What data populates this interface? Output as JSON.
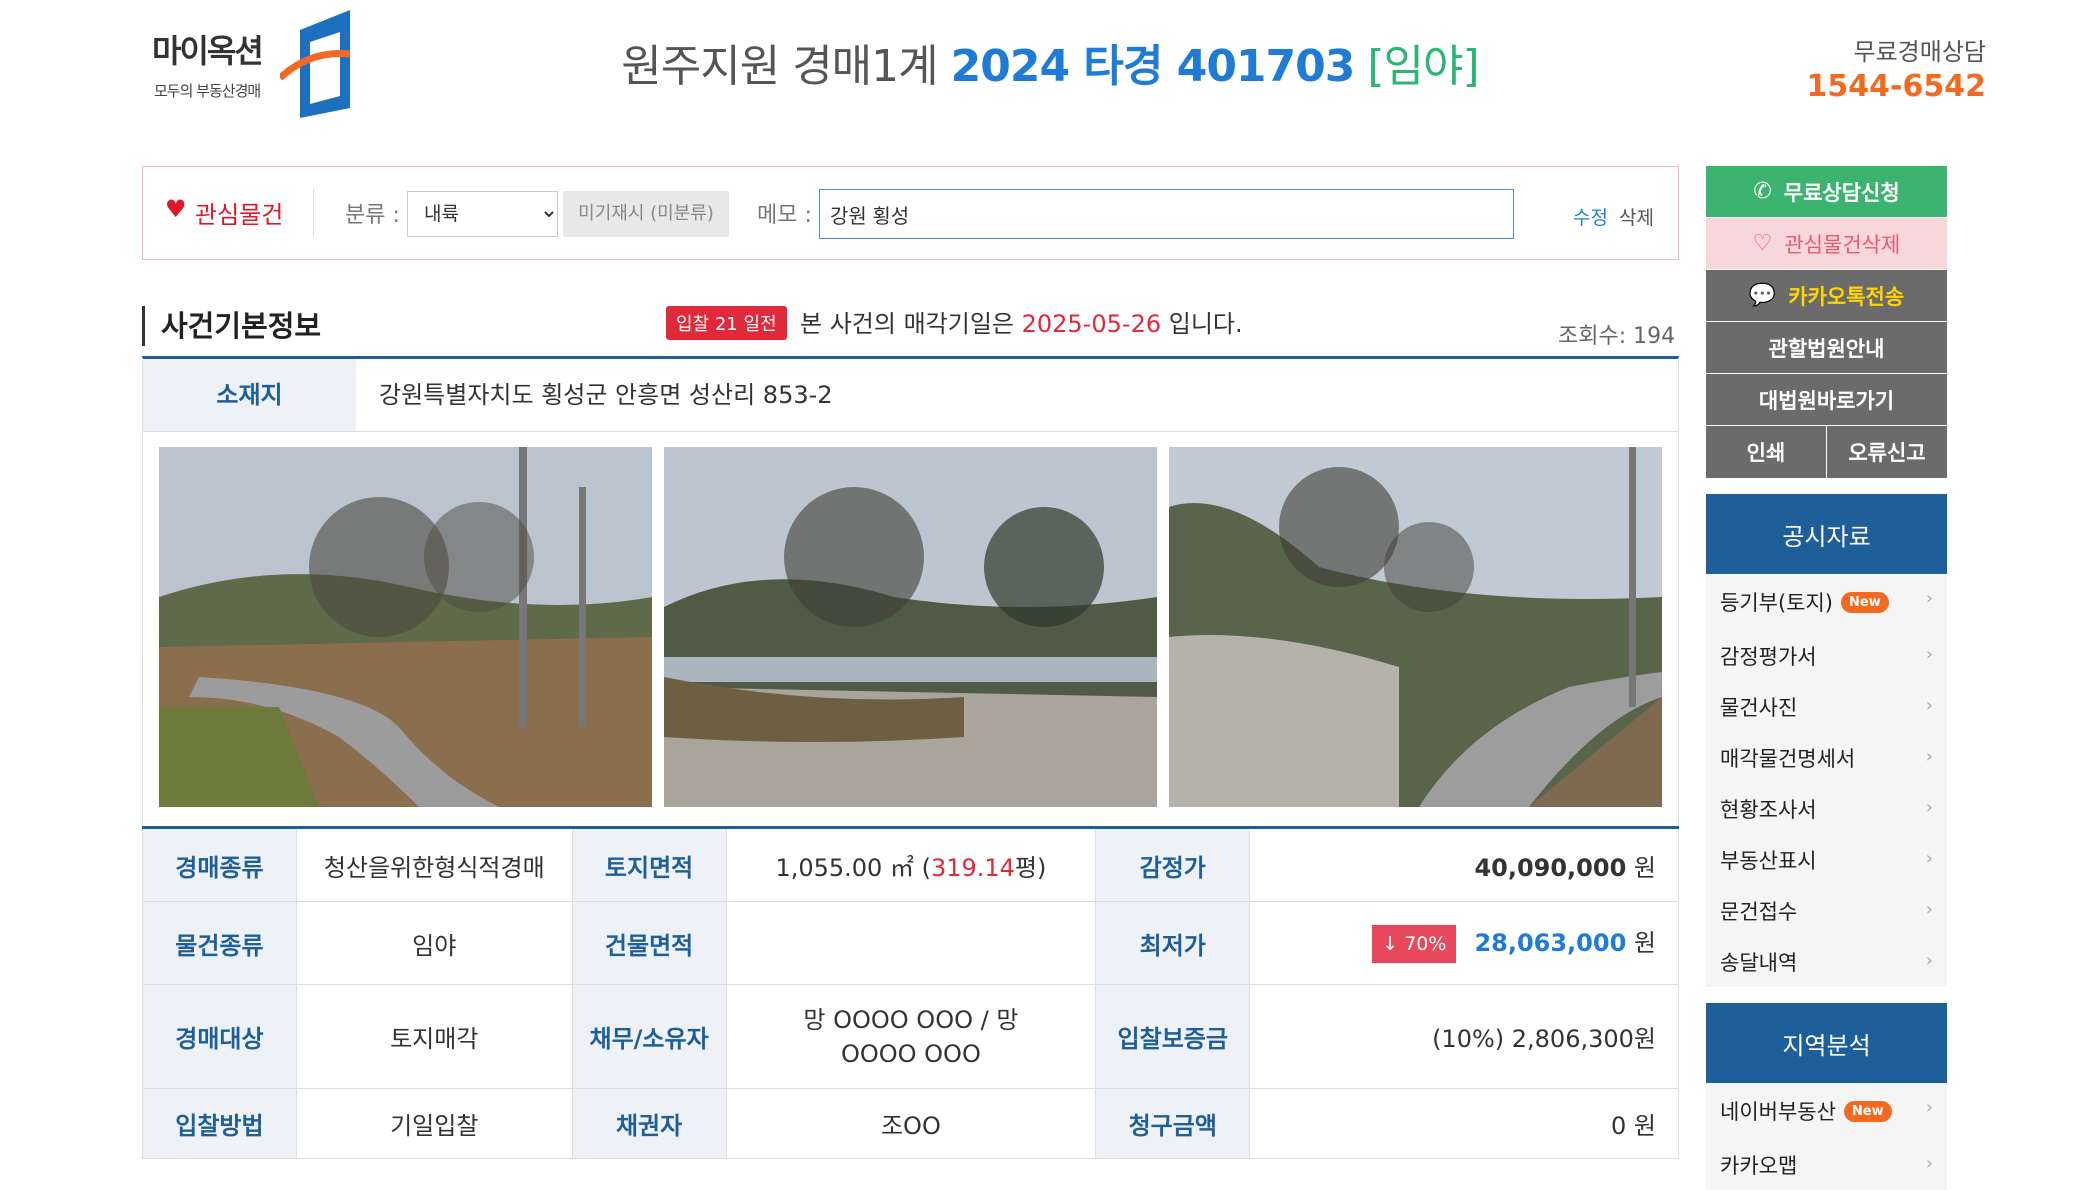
{
  "header": {
    "logo_text": "마이옥션",
    "logo_sub": "모두의 부동산경매",
    "court": "원주지원 경매1계",
    "case_no": "2024 타경 401703",
    "type": "[임야]",
    "consult_label": "무료경매상담",
    "consult_phone": "1544-6542"
  },
  "favbar": {
    "fav_label": "관심물건",
    "category_label": "분류 :",
    "category_value": "내륙",
    "uncategorized": "미기재시 (미분류)",
    "memo_label": "메모 :",
    "memo_value": "강원 횡성",
    "edit": "수정",
    "delete": "삭제"
  },
  "case": {
    "section_title": "사건기본정보",
    "dday_badge": "입찰 21 일전",
    "notice_pre": "본 사건의 매각기일은",
    "sale_date": "2025-05-26",
    "notice_post": "입니다.",
    "views": "조회수: 194",
    "address_label": "소재지",
    "address": "강원특별자치도 횡성군 안흥면 성산리 853-2"
  },
  "info": {
    "r1": {
      "h1": "경매종류",
      "v1": "청산을위한형식적경매",
      "h2": "토지면적",
      "area": "1,055.00 ㎡ (",
      "pyeong": "319.14",
      "pyeong_unit": "평)",
      "h3": "감정가",
      "appraisal": "40,090,000",
      "unit": "원"
    },
    "r2": {
      "h1": "물건종류",
      "v1": "임야",
      "h2": "건물면적",
      "v2": "",
      "h3": "최저가",
      "pct": "↓ 70%",
      "minimum": "28,063,000",
      "unit": "원"
    },
    "r3": {
      "h1": "경매대상",
      "v1": "토지매각",
      "h2": "채무/소유자",
      "v2": "망 OOOO OOO / 망 OOOO OOO",
      "h3": "입찰보증금",
      "deposit": "(10%) 2,806,300원"
    },
    "r4": {
      "h1": "입찰방법",
      "v1": "기일입찰",
      "h2": "채권자",
      "v2": "조OO",
      "h3": "청구금액",
      "claim": "0 원"
    }
  },
  "sidebar": {
    "consult_btn": "무료상담신청",
    "fav_delete_btn": "관심물건삭제",
    "kakao_btn": "카카오톡전송",
    "court_btn": "관할법원안내",
    "supreme_btn": "대법원바로가기",
    "print_btn": "인쇄",
    "report_btn": "오류신고",
    "public_title": "공시자료",
    "public_items": [
      "등기부(토지)",
      "감정평가서",
      "물건사진",
      "매각물건명세서",
      "현황조사서",
      "부동산표시",
      "문건접수",
      "송달내역"
    ],
    "new_badge": "New",
    "region_title": "지역분석",
    "region_items": [
      "네이버부동산",
      "카카오맵"
    ]
  },
  "colors": {
    "brand_blue": "#1e5f99",
    "accent_blue": "#1e7bd6",
    "accent_orange": "#f26a21",
    "accent_green": "#3cb371",
    "alert_red": "#e0293a"
  }
}
